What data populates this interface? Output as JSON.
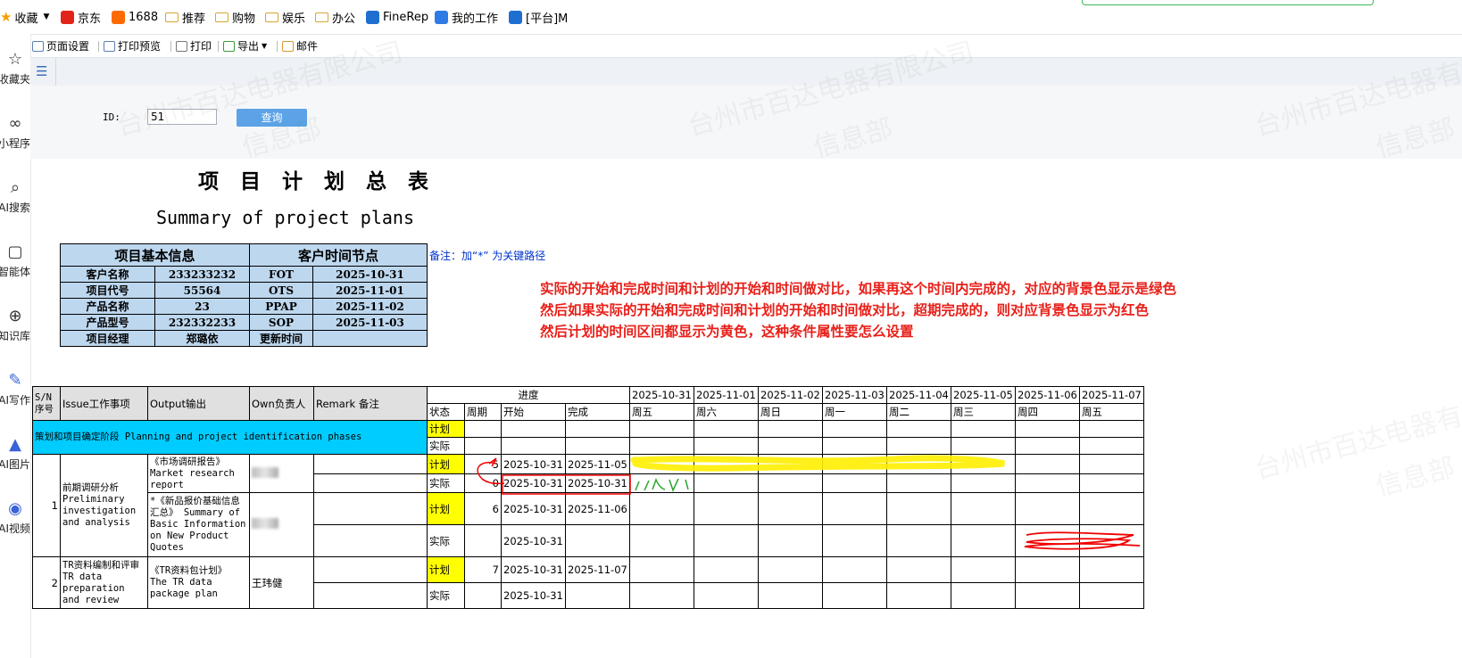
{
  "bookmarks": [
    {
      "label": "收藏",
      "icon": "star-icon"
    },
    {
      "label": "京东",
      "icon": "jd-icon"
    },
    {
      "label": "1688",
      "icon": "1688-icon"
    },
    {
      "label": "推荐",
      "icon": "folder-icon"
    },
    {
      "label": "购物",
      "icon": "folder-icon"
    },
    {
      "label": "娱乐",
      "icon": "folder-icon"
    },
    {
      "label": "办公",
      "icon": "folder-icon"
    },
    {
      "label": "FineRep",
      "icon": "finereport-icon"
    },
    {
      "label": "我的工作",
      "icon": "work-icon"
    },
    {
      "label": "[平台]M",
      "icon": "finereport-icon"
    }
  ],
  "left_rail": [
    {
      "label": "收藏夹",
      "icon": "star-icon"
    },
    {
      "label": "小程序",
      "icon": "miniprogram-icon"
    },
    {
      "label": "AI搜索",
      "icon": "search-icon"
    },
    {
      "label": "智能体",
      "icon": "agent-icon"
    },
    {
      "label": "知识库",
      "icon": "knowledge-icon"
    },
    {
      "label": "AI写作",
      "icon": "write-icon"
    },
    {
      "label": "AI图片",
      "icon": "image-icon"
    },
    {
      "label": "AI视频",
      "icon": "video-icon"
    }
  ],
  "toolbar": {
    "page_setup": "页面设置",
    "print_preview": "打印预览",
    "print": "打印",
    "export": "导出",
    "mail": "邮件"
  },
  "params": {
    "id_label": "ID:",
    "id_value": "51",
    "query_button": "查询"
  },
  "watermark": {
    "line1": "台州市百达电器有限公司",
    "line2": "信息部"
  },
  "report": {
    "title_cn": "项 目 计 划 总 表",
    "title_en": "Summary of project plans",
    "note": "备注：加“*” 为关键路径"
  },
  "info": {
    "header_left": "项目基本信息",
    "header_right": "客户时间节点",
    "rows": [
      {
        "k1": "客户名称",
        "v1": "233233232",
        "k2": "FOT",
        "v2": "2025-10-31"
      },
      {
        "k1": "项目代号",
        "v1": "55564",
        "k2": "OTS",
        "v2": "2025-11-01"
      },
      {
        "k1": "产品名称",
        "v1": "23",
        "k2": "PPAP",
        "v2": "2025-11-02"
      },
      {
        "k1": "产品型号",
        "v1": "232332233",
        "k2": "SOP",
        "v2": "2025-11-03"
      },
      {
        "k1": "项目经理",
        "v1": "郑璐依",
        "k2": "更新时间",
        "v2": ""
      }
    ]
  },
  "question": [
    "实际的开始和完成时间和计划的开始和时间做对比，如果再这个时间内完成的，对应的背景色显示是绿色",
    "然后如果实际的开始和完成时间和计划的开始和时间做对比，超期完成的，则对应背景色显示为红色",
    "然后计划的时间区间都显示为黄色，这种条件属性要怎么设置"
  ],
  "grid": {
    "h_sn": "S/N 序号",
    "h_issue": "Issue工作事项",
    "h_output": "Output输出",
    "h_owner": "Own负责人",
    "h_remark": "Remark 备注",
    "h_progress": "进度",
    "h_status": "状态",
    "h_period": "周期",
    "h_start": "开始",
    "h_finish": "完成",
    "dates": [
      "2025-10-31",
      "2025-11-01",
      "2025-11-02",
      "2025-11-03",
      "2025-11-04",
      "2025-11-05",
      "2025-11-06",
      "2025-11-07"
    ],
    "weekdays": [
      "周五",
      "周六",
      "周日",
      "周一",
      "周二",
      "周三",
      "周四",
      "周五"
    ],
    "phase": {
      "label": "策划和项目确定阶段 Planning and project identification phases",
      "plan_label": "计划",
      "actual_label": "实际"
    },
    "tasks": [
      {
        "sn": "1",
        "issue": "前期调研分析 Preliminary investigation and analysis",
        "items": [
          {
            "output": "《市场调研报告》 Market research report",
            "plan": {
              "status": "计划",
              "period": "5",
              "start": "2025-10-31",
              "finish": "2025-11-05"
            },
            "actual": {
              "status": "实际",
              "period": "0",
              "start": "2025-10-31",
              "finish": "2025-10-31"
            }
          },
          {
            "output": "*《新品报价基础信息汇总》 Summary of Basic Information on New Product Quotes",
            "plan": {
              "status": "计划",
              "period": "6",
              "start": "2025-10-31",
              "finish": "2025-11-06"
            },
            "actual": {
              "status": "实际",
              "period": "",
              "start": "2025-10-31",
              "finish": ""
            }
          }
        ]
      },
      {
        "sn": "2",
        "issue": "TR资料编制和评审 TR data preparation and review",
        "owner": "王玮健",
        "items": [
          {
            "output": "《TR资料包计划》 The TR data package plan",
            "plan": {
              "status": "计划",
              "period": "7",
              "start": "2025-10-31",
              "finish": "2025-11-07"
            },
            "actual": {
              "status": "实际",
              "period": "",
              "start": "2025-10-31",
              "finish": ""
            }
          }
        ]
      }
    ]
  },
  "colors": {
    "info_bg": "#bdd7ee",
    "phase_bg": "#00ccff",
    "plan_bg": "#ffff00",
    "header_bg": "#e0e0e0",
    "question_text": "#e8201a",
    "note_text": "#0033cc",
    "query_button": "#5ba3e6"
  }
}
